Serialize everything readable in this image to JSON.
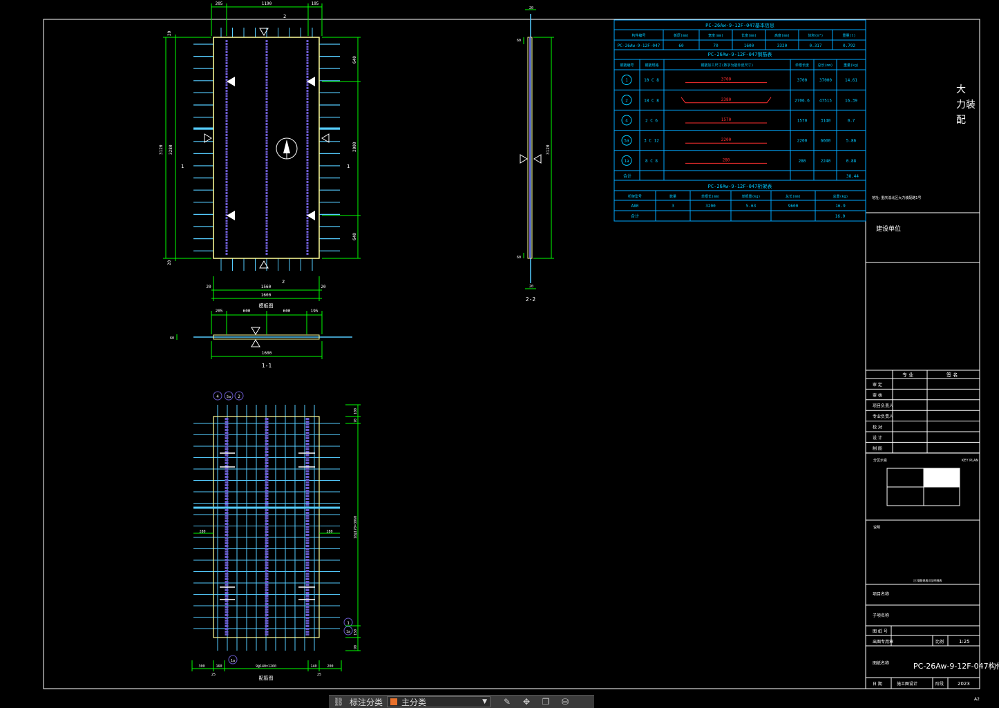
{
  "drawing": {
    "title_block": {
      "logo_chars": [
        "大",
        "力装",
        "配"
      ],
      "small_note": "地址: 重庆渝北区大力装配路1号",
      "construction_unit_label": "建设单位",
      "sign_header": [
        "专 业",
        "签 名"
      ],
      "sign_rows": [
        "审 定",
        "审 核",
        "项目负责人",
        "专业负责人",
        "校 对",
        "设 计",
        "制 图"
      ],
      "key_plan_label": "分区示意",
      "key_plan_tag": "KEY PLAN",
      "notes_label": "说明",
      "notes_text": "注:钢筋规格详见明细表",
      "project_name_label": "项目名称",
      "subitem_label": "子项名称",
      "drawing_no_label": "图 纸 号",
      "scale_row_label": "出图专用章",
      "scale_label": "比例",
      "scale_value": "1:25",
      "drawing_name_label": "图纸名称",
      "drawing_name": "PC-26Aw-9-12F-047构件图",
      "date_label": "日 期",
      "date_value": "2023",
      "sheet_label": "阶段",
      "sheet_value": "施工图设计",
      "size_mark": "A2"
    },
    "tables": {
      "component": {
        "title": "PC-26Aw-9-12F-047基本信息",
        "headers": [
          "构件编号",
          "板厚(mm)",
          "宽度(mm)",
          "长度(mm)",
          "高度(mm)",
          "体积(m³)",
          "重量(t)"
        ],
        "row": [
          "PC-26Aw-9-12F-047",
          "60",
          "70",
          "1600",
          "3320",
          "0.317",
          "0.792"
        ]
      },
      "rebar": {
        "title": "PC-26Aw-9-12F-047钢筋表",
        "headers": [
          "钢筋编号",
          "钢筋规格",
          "钢筋加工尺寸(数字为筋外皮尺寸)",
          "单根长度",
          "总长(mm)",
          "重量(kg)"
        ],
        "rows": [
          {
            "id": "1",
            "spec": "10 C 8",
            "dim": "3700",
            "len": "3700",
            "total": "37000",
            "weight": "14.61"
          },
          {
            "id": "2",
            "spec": "18 C 8",
            "dim": "2380",
            "len": "2706.6",
            "total": "47515",
            "weight": "16.39"
          },
          {
            "id": "4",
            "spec": "2 C 6",
            "dim": "1570",
            "len": "1570",
            "total": "3140",
            "weight": "0.7"
          },
          {
            "id": "5a",
            "spec": "3 C 12",
            "dim": "2200",
            "len": "2200",
            "total": "6600",
            "weight": "5.86"
          },
          {
            "id": "1a",
            "spec": "8 C 8",
            "dim": "280",
            "len": "280",
            "total": "2240",
            "weight": "0.88"
          }
        ],
        "total_label": "合计",
        "total_value": "38.44"
      },
      "truss": {
        "title": "PC-26Aw-9-12F-047桁架表",
        "headers": [
          "桁架型号",
          "数量",
          "单根长(mm)",
          "单根重(kg)",
          "总长(mm)",
          "总重(kg)"
        ],
        "row": [
          "A80",
          "3",
          "3200",
          "5.63",
          "9600",
          "16.9"
        ],
        "total_label": "合计",
        "total_value": "16.9"
      }
    },
    "plan": {
      "top_dims": [
        "205",
        "1190",
        "195"
      ],
      "left_dims": [
        "20",
        "3120",
        "3280",
        "20"
      ],
      "right_dims": [
        "640",
        "2000",
        "640"
      ],
      "bottom_dims_inner": [
        "20",
        "1560",
        "20"
      ],
      "bottom_dim_total": "1600",
      "caption": "模板图",
      "mark_top": "2",
      "mark_bottom": "2",
      "mark_left": "1",
      "mark_right": "1"
    },
    "section11": {
      "top_dims": [
        "205",
        "600",
        "600",
        "195"
      ],
      "bottom_dim": "1600",
      "thickness": "60",
      "caption": "1-1"
    },
    "section22": {
      "top_dim": "20",
      "bottom_dim": "20",
      "height_dim": "3120",
      "thick": "60",
      "caption": "2-2"
    },
    "rebar_plan": {
      "bubbles_top": [
        "4",
        "5a",
        "2"
      ],
      "bubble_right": "1",
      "bubble_right2": "1a",
      "bubble_bottom": "1a",
      "right_dims": [
        "100",
        "70",
        "18@170=3060",
        "150",
        "90"
      ],
      "left_dim": "280",
      "right_mid_dim": "280",
      "bottom_dims": [
        "300",
        "160",
        "9@140=1260",
        "140",
        "200"
      ],
      "bottom_dims2": [
        "25",
        "25"
      ],
      "caption": "配筋图"
    }
  },
  "toolbar": {
    "label1": "标注分类",
    "select_value": "主分类",
    "icons": [
      "link-icon",
      "edit-icon",
      "move-icon",
      "copy-icon",
      "stack-icon"
    ]
  },
  "colors": {
    "frame": "#ffffff",
    "table_line": "#00a8ff",
    "dim_line": "#00ff00",
    "rebar": "#55ccff",
    "truss": "#6a5acd",
    "outline": "#ffff99",
    "red": "#ff3030",
    "text": "#ffffff"
  }
}
